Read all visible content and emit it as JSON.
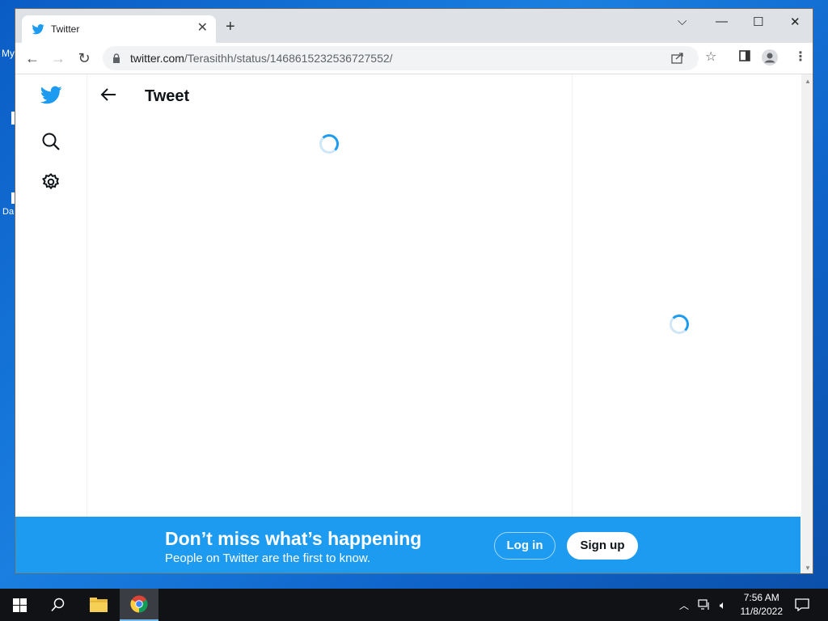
{
  "desktop": {
    "frag_a": "My",
    "frag_d": "Da"
  },
  "browser": {
    "tab_title": "Twitter",
    "url_host": "twitter.com",
    "url_path": "/Terasithh/status/1468615232536727552/"
  },
  "page": {
    "header_title": "Tweet"
  },
  "banner": {
    "title": "Don’t miss what’s happening",
    "subtitle": "People on Twitter are the first to know.",
    "login_label": "Log in",
    "signup_label": "Sign up"
  },
  "taskbar": {
    "time": "7:56 AM",
    "date": "11/8/2022"
  },
  "colors": {
    "twitter_blue": "#1d9bf0",
    "taskbar_bg": "#101216"
  }
}
